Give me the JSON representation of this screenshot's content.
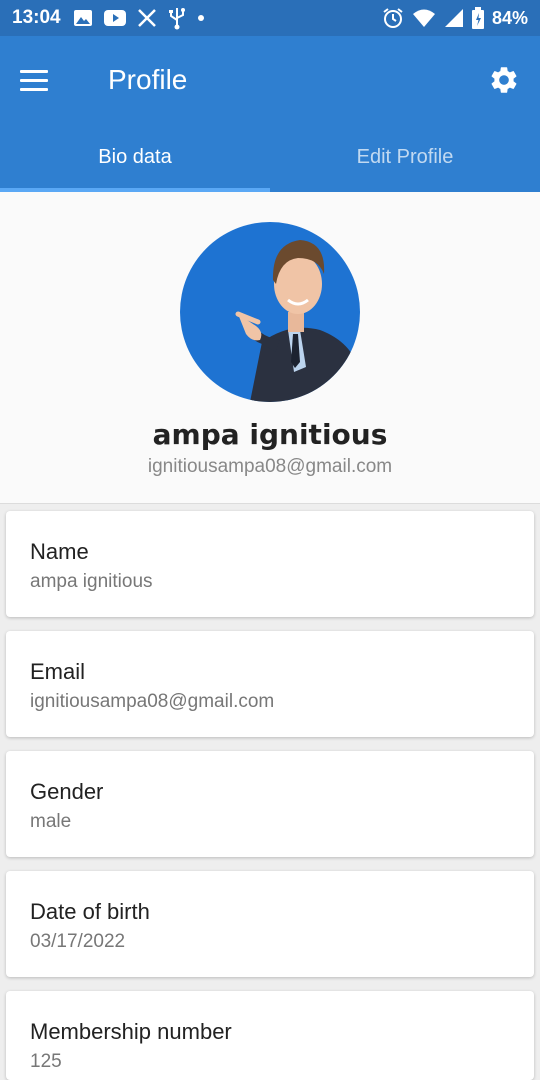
{
  "status_bar": {
    "time": "13:04",
    "battery": "84%",
    "left_icons": [
      "image-icon",
      "youtube-icon",
      "x-icon",
      "usb-icon",
      "dot-icon"
    ],
    "right_icons": [
      "alarm-icon",
      "wifi-icon",
      "signal-icon",
      "battery-icon"
    ]
  },
  "app_bar": {
    "title": "Profile"
  },
  "tabs": [
    {
      "label": "Bio data",
      "active": true
    },
    {
      "label": "Edit Profile",
      "active": false
    }
  ],
  "profile": {
    "name": "ampa ignitious",
    "email": "ignitiousampa08@gmail.com"
  },
  "fields": [
    {
      "label": "Name",
      "value": "ampa ignitious"
    },
    {
      "label": "Email",
      "value": "ignitiousampa08@gmail.com"
    },
    {
      "label": "Gender",
      "value": "male"
    },
    {
      "label": "Date of birth",
      "value": "03/17/2022"
    },
    {
      "label": "Membership number",
      "value": "125"
    }
  ],
  "colors": {
    "status_bar": "#2a6fb8",
    "app_bar": "#2f7fd0",
    "tab_indicator": "#5aa8f5",
    "avatar_bg": "#1e73d2"
  }
}
